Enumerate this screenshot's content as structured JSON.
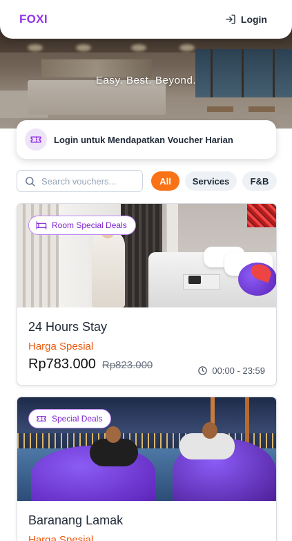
{
  "header": {
    "logo": "FOXI",
    "login_label": "Login"
  },
  "hero": {
    "tagline": "Easy. Best. Beyond."
  },
  "voucher_banner": {
    "text": "Login untuk Mendapatkan Voucher Harian"
  },
  "search": {
    "placeholder": "Search vouchers..."
  },
  "filters": [
    {
      "label": "All",
      "active": true
    },
    {
      "label": "Services",
      "active": false
    },
    {
      "label": "F&B",
      "active": false
    }
  ],
  "vouchers": [
    {
      "badge": "Room Special Deals",
      "title": "24 Hours Stay",
      "subtitle": "Harga Spesial",
      "price": "Rp783.000",
      "original_price": "Rp823.000",
      "time": "00:00 - 23:59"
    },
    {
      "badge": "Special Deals",
      "title": "Baranang Lamak",
      "subtitle": "Harga Spesial"
    }
  ],
  "colors": {
    "brand": "#9333ea",
    "accent": "#f97316",
    "subtitle": "#ea580c"
  }
}
